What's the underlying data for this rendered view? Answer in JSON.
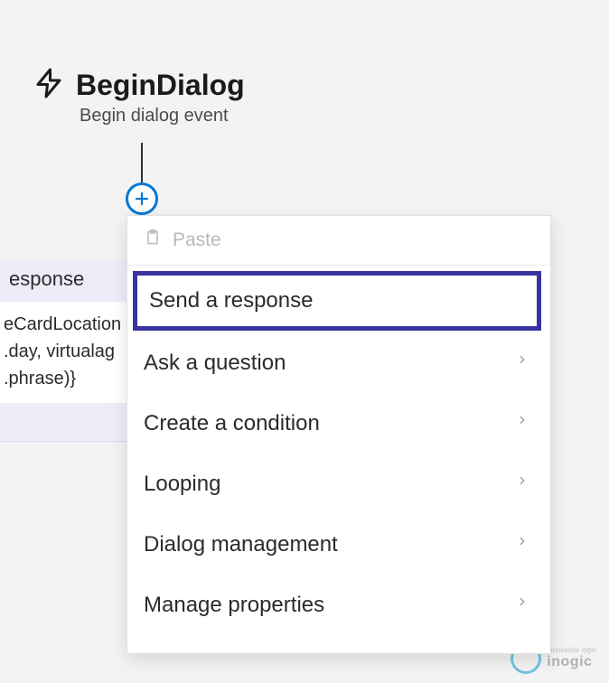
{
  "trigger": {
    "title": "BeginDialog",
    "subtitle": "Begin dialog event"
  },
  "card": {
    "header": "esponse",
    "line1": "eCardLocation",
    "line2": ".day, virtualag",
    "line3": ".phrase)}"
  },
  "popup": {
    "paste": "Paste",
    "items": [
      {
        "label": "Send a response",
        "hasSubmenu": false,
        "highlighted": true
      },
      {
        "label": "Ask a question",
        "hasSubmenu": true,
        "highlighted": false
      },
      {
        "label": "Create a condition",
        "hasSubmenu": true,
        "highlighted": false
      },
      {
        "label": "Looping",
        "hasSubmenu": true,
        "highlighted": false
      },
      {
        "label": "Dialog management",
        "hasSubmenu": true,
        "highlighted": false
      },
      {
        "label": "Manage properties",
        "hasSubmenu": true,
        "highlighted": false
      }
    ]
  },
  "watermark": {
    "brand": "inogic",
    "tag": "innovative logic"
  }
}
